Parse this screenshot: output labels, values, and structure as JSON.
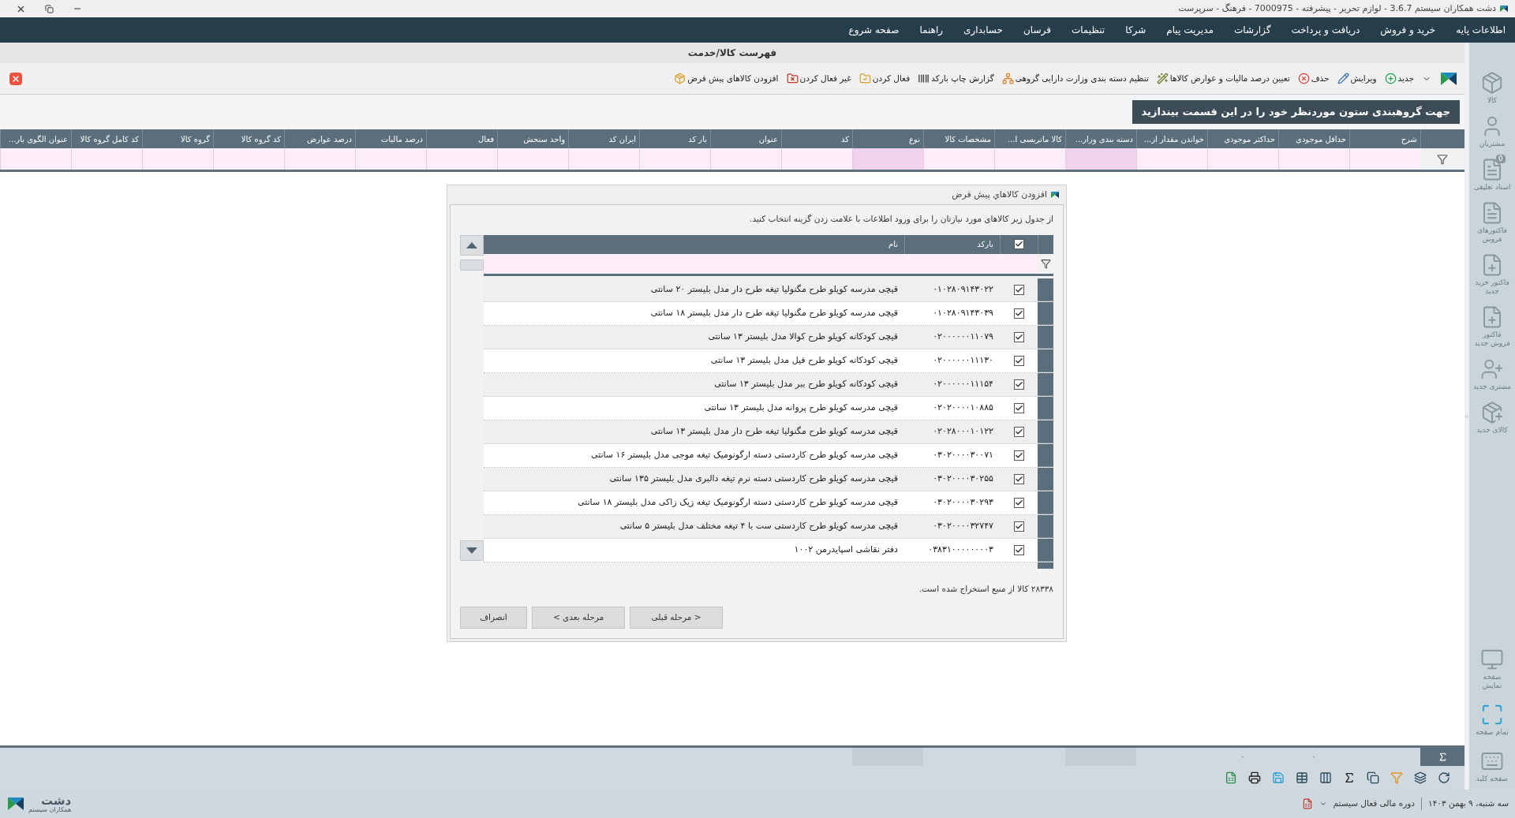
{
  "window": {
    "title": "دشت همکاران سیستم 3.6.7 - لوازم تحریر - پیشرفته - 7000975 - فرهنگ - سرپرست"
  },
  "menu": [
    "اطلاعات پایه",
    "خرید و فروش",
    "دریافت و پرداخت",
    "گزارشات",
    "مدیریت پیام",
    "شرکا",
    "تنظیمات",
    "فرسان",
    "حسابداری",
    "راهنما",
    "صفحه شروع"
  ],
  "form_title": "فهرست کالا/خدمت",
  "toolbar": [
    {
      "label": "جدید",
      "kind": "add"
    },
    {
      "label": "ویرایش",
      "kind": "edit"
    },
    {
      "label": "حذف",
      "kind": "delete"
    },
    {
      "label": "تعیین درصد مالیات و عوارض کالاها",
      "kind": "tax"
    },
    {
      "label": "تنظیم دسته بندی وزارت دارایی گروهی",
      "kind": "category"
    },
    {
      "label": "گزارش چاپ بارکد",
      "kind": "barcode"
    },
    {
      "label": "فعال کردن",
      "kind": "activate"
    },
    {
      "label": "غیر فعال کردن",
      "kind": "deactivate"
    },
    {
      "label": "افزودن کالاهای پیش فرض",
      "kind": "defaults"
    }
  ],
  "group_hint": "جهت گروهبندی ستون موردنظر خود را در این قسمت بیندازید",
  "columns": [
    {
      "label": "شرح",
      "highlighted": false
    },
    {
      "label": "حداقل موجودی",
      "highlighted": false,
      "summary": "۰"
    },
    {
      "label": "حداکثر موجودی",
      "highlighted": false,
      "summary": "۰"
    },
    {
      "label": "خواندن مقدار از...",
      "highlighted": false
    },
    {
      "label": "دسته بندی وزار...",
      "highlighted": true
    },
    {
      "label": "کالا ماتریسی ا...",
      "highlighted": false
    },
    {
      "label": "مشخصات کالا",
      "highlighted": false
    },
    {
      "label": "نوع",
      "highlighted": true
    },
    {
      "label": "کد",
      "highlighted": false
    },
    {
      "label": "عنوان",
      "highlighted": false
    },
    {
      "label": "بار کد",
      "highlighted": false
    },
    {
      "label": "ایران کد",
      "highlighted": false
    },
    {
      "label": "واحد سنجش",
      "highlighted": false
    },
    {
      "label": "فعال",
      "highlighted": false
    },
    {
      "label": "درصد مالیات",
      "highlighted": false
    },
    {
      "label": "درصد عوارض",
      "highlighted": false
    },
    {
      "label": "کد گروه کالا",
      "highlighted": false
    },
    {
      "label": "گروه کالا",
      "highlighted": false
    },
    {
      "label": "کد کامل گروه کالا",
      "highlighted": false
    },
    {
      "label": "عنوان الگوی بار...",
      "highlighted": false
    }
  ],
  "dialog": {
    "title": "افزودن کالاهاي پيش فرض",
    "instruction": "از جدول زیر کالاهای مورد نیازتان را برای ورود اطلاعات با علامت زدن گزینه انتخاب کنید.",
    "select_all_checked": true,
    "columns": [
      "بارکد",
      "نام"
    ],
    "rows": [
      {
        "checked": true,
        "barcode": "۰۱۰۲۸۰۹۱۴۳۰۲۲",
        "name": "قیچی مدرسه کویلو طرح مگنولیا تیغه طرح دار مدل بلیستر ۲۰ سانتی"
      },
      {
        "checked": true,
        "barcode": "۰۱۰۲۸۰۹۱۴۳۰۳۹",
        "name": "قیچی مدرسه کویلو طرح مگنولیا تیغه طرح دار مدل بلیستر ۱۸ سانتی"
      },
      {
        "checked": true,
        "barcode": "۰۲۰۰۰۰۰۰۱۱۰۷۹",
        "name": "قیچی کودکانه کویلو طرح کوالا مدل بلیستر ۱۳ سانتی"
      },
      {
        "checked": true,
        "barcode": "۰۲۰۰۰۰۰۰۱۱۱۳۰",
        "name": "قیچی کودکانه کویلو طرح فیل مدل بلیستر ۱۳ سانتی"
      },
      {
        "checked": true,
        "barcode": "۰۲۰۰۰۰۰۰۱۱۱۵۴",
        "name": "قیچی کودکانه کویلو طرح ببر مدل بلیستر ۱۳ سانتی"
      },
      {
        "checked": true,
        "barcode": "۰۲۰۲۰۰۰۰۱۰۸۸۵",
        "name": "قیچی مدرسه کویلو طرح پروانه مدل بلیستر ۱۳ سانتی"
      },
      {
        "checked": true,
        "barcode": "۰۲۰۲۸۰۰۰۱۰۱۲۲",
        "name": "قیچی مدرسه کویلو طرح مگنولیا تیغه طرح دار مدل بلیستر ۱۳ سانتی"
      },
      {
        "checked": true,
        "barcode": "۰۳۰۲۰۰۰۰۳۰۰۷۱",
        "name": "قیچی مدرسه کویلو طرح کاردستی دسته ارگونومیک تیغه موجی مدل بلیستر ۱۶ سانتی"
      },
      {
        "checked": true,
        "barcode": "۰۳۰۲۰۰۰۰۳۰۲۵۵",
        "name": "قیچی مدرسه کویلو طرح کاردستی دسته نرم تیغه دالبری مدل بلیستر ۱۳۵ سانتی"
      },
      {
        "checked": true,
        "barcode": "۰۳۰۲۰۰۰۰۳۰۲۹۳",
        "name": "قیچی مدرسه کویلو طرح کاردستی دسته ارگونومیک تیغه زیک زاکی مدل بلیستر ۱۸ سانتی"
      },
      {
        "checked": true,
        "barcode": "۰۳۰۲۰۰۰۰۳۲۷۴۷",
        "name": "قیچی مدرسه کویلو طرح کاردستی ست با ۴ تیغه مختلف مدل بلیستر ۵ سانتی"
      },
      {
        "checked": true,
        "barcode": "۰۳۸۳۱۰۰۰۰۰۰۰۰۳",
        "name": "دفتر نقاشی اسپایدرمن ۱۰۰۲"
      }
    ],
    "count_text": "۲۸۳۳۸ کالا از منبع استخراج شده است.",
    "buttons": [
      "< مرحله قبلی",
      "مرحله بعدی >",
      "انصراف"
    ]
  },
  "sidebar": [
    {
      "label": "کالا",
      "kind": "goods"
    },
    {
      "label": "مشتریان",
      "kind": "person"
    },
    {
      "label": "اسناد تعلیقی",
      "kind": "document",
      "badge": "0"
    },
    {
      "label": "فاکتورهای فروش",
      "kind": "document"
    },
    {
      "label": "فاکتور خرید جدید",
      "kind": "new-document"
    },
    {
      "label": "فاکتور فروش جدید",
      "kind": "new-document"
    },
    {
      "label": "مشتری جدید",
      "kind": "new-person"
    },
    {
      "label": "کالای جدید",
      "kind": "new-goods"
    }
  ],
  "sidebar_bottom": [
    {
      "label": "صفحه نمایش",
      "kind": "monitor"
    },
    {
      "label": "تمام صفحه",
      "kind": "fullscreen"
    },
    {
      "label": "صفحه کلید",
      "kind": "keyboard"
    }
  ],
  "status": {
    "date": "سه شنبه، ۹ بهمن ۱۴۰۳",
    "period": "دوره مالی فعال سیستم"
  },
  "logo": {
    "name": "دشت",
    "subtitle": "همکاران سیستم"
  }
}
